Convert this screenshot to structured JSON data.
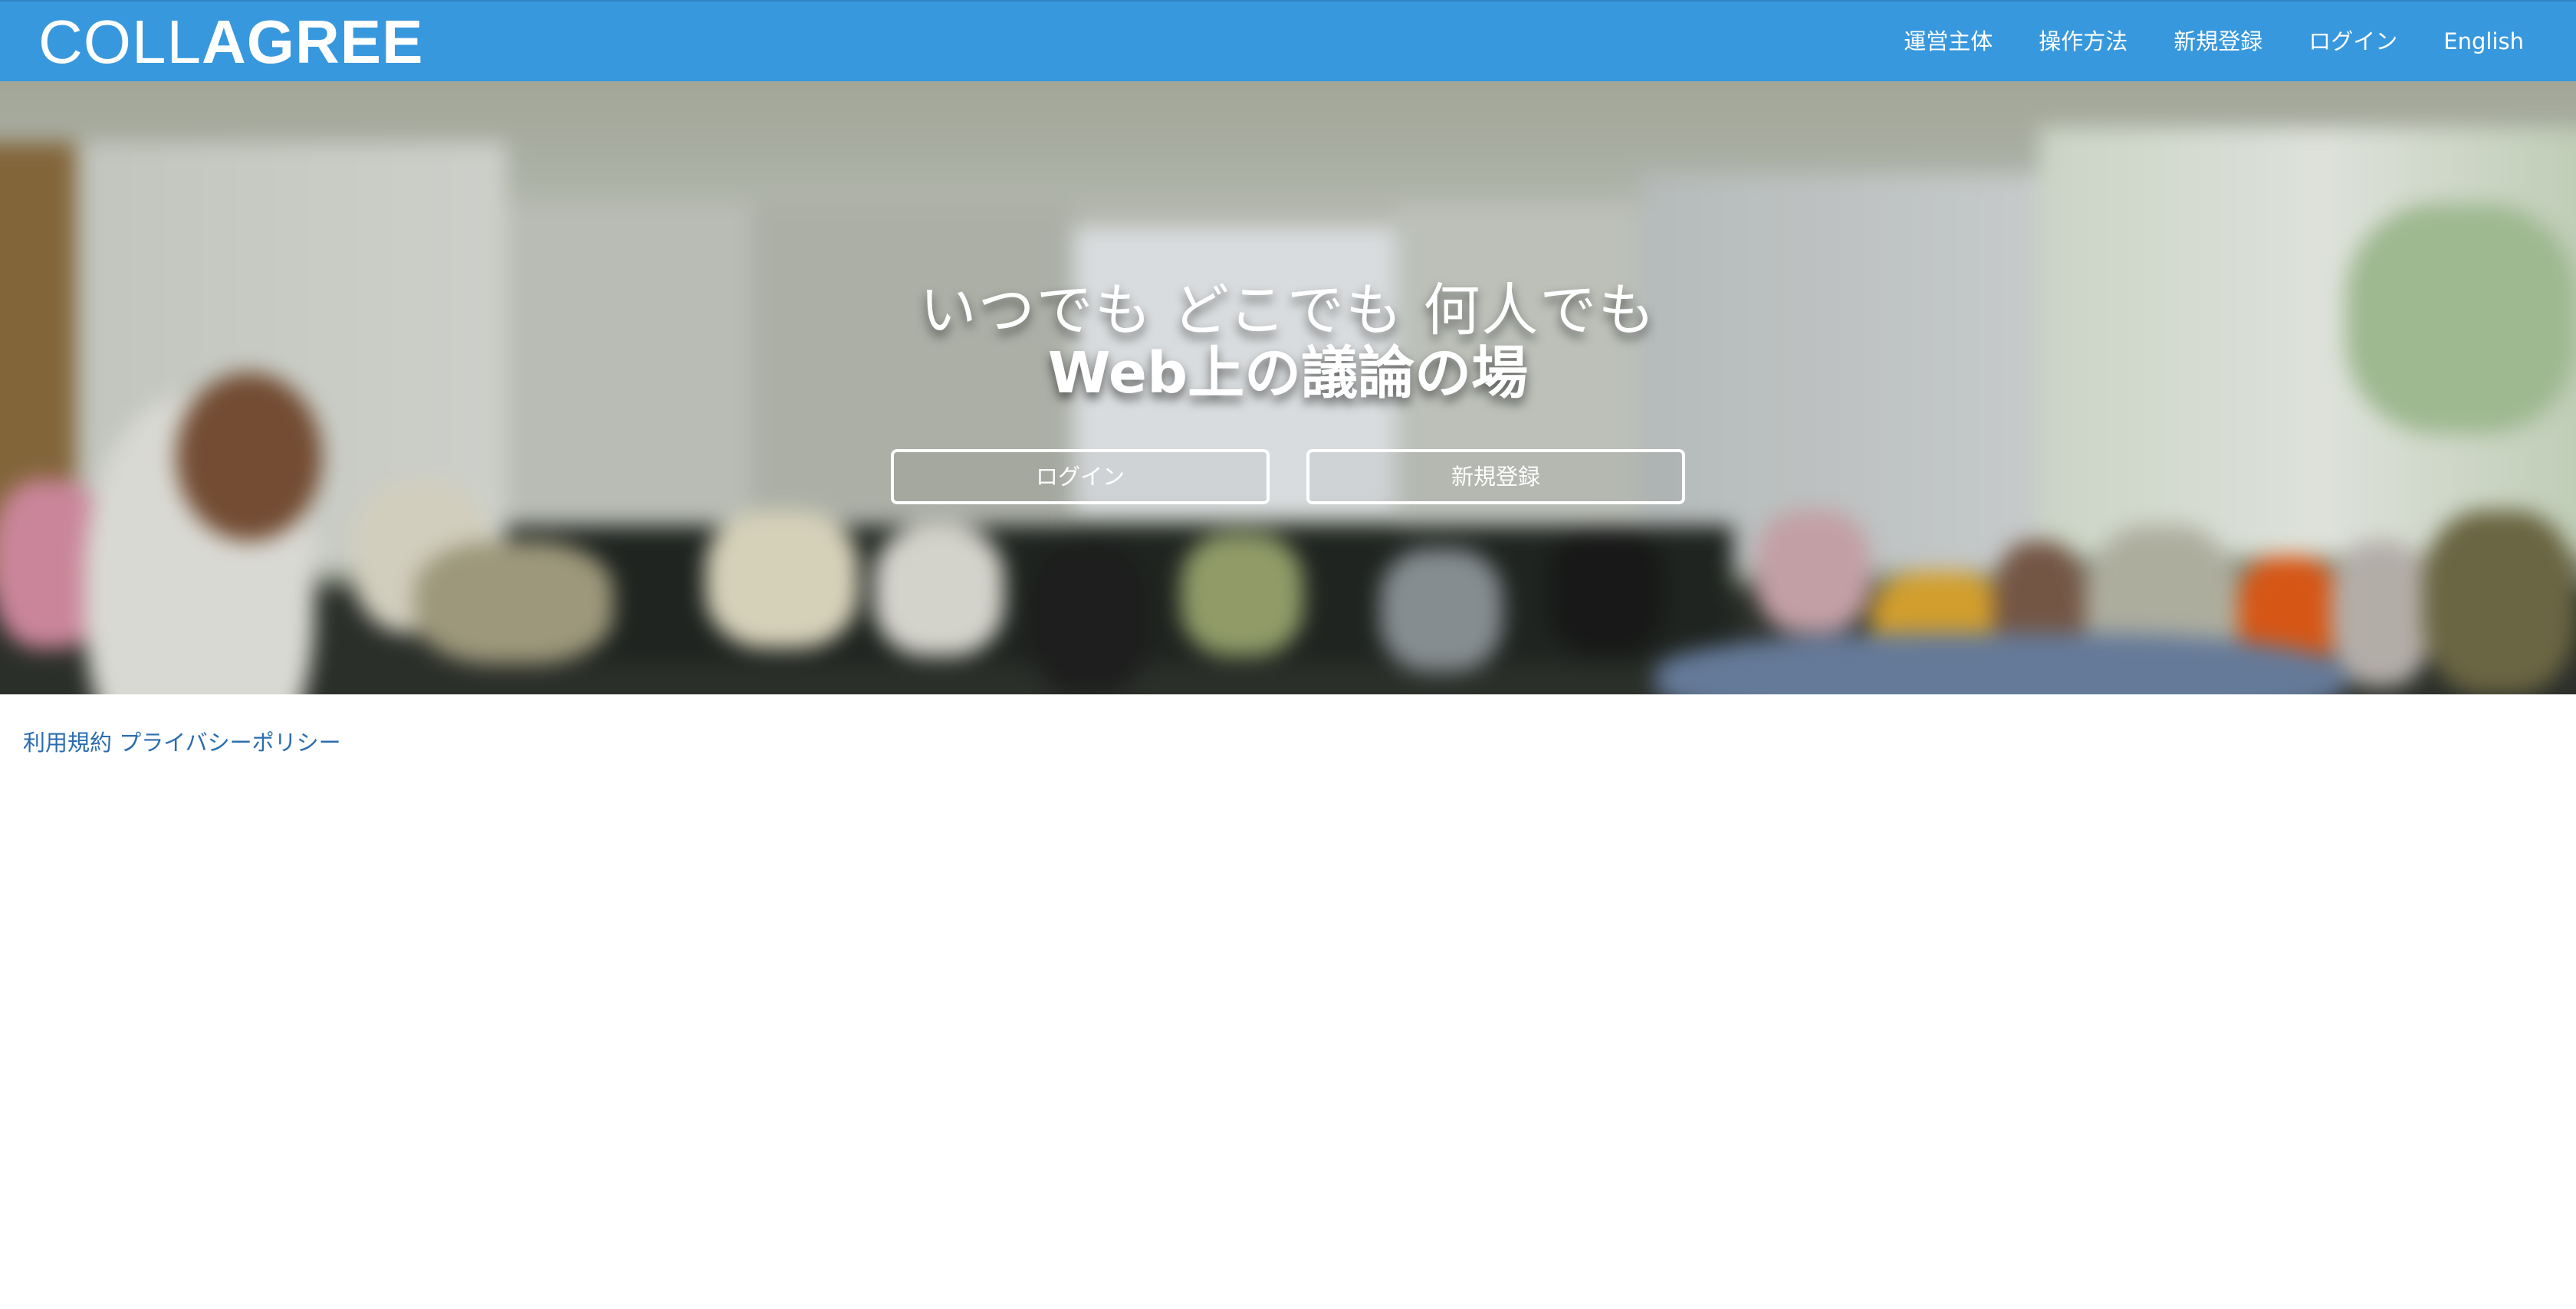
{
  "brand": {
    "light": "COLL",
    "bold": "AGREE"
  },
  "nav": {
    "items": [
      {
        "label": "運営主体"
      },
      {
        "label": "操作方法"
      },
      {
        "label": "新規登録"
      },
      {
        "label": "ログイン"
      },
      {
        "label": "English"
      }
    ]
  },
  "hero": {
    "title_line1": "いつでも どこでも 何人でも",
    "title_line2": "Web上の議論の場",
    "login_button": "ログイン",
    "signup_button": "新規登録"
  },
  "footer": {
    "terms": "利用規約",
    "privacy": "プライバシーポリシー"
  },
  "colors": {
    "navbar": "#3898dd",
    "link": "#2a6db0"
  }
}
